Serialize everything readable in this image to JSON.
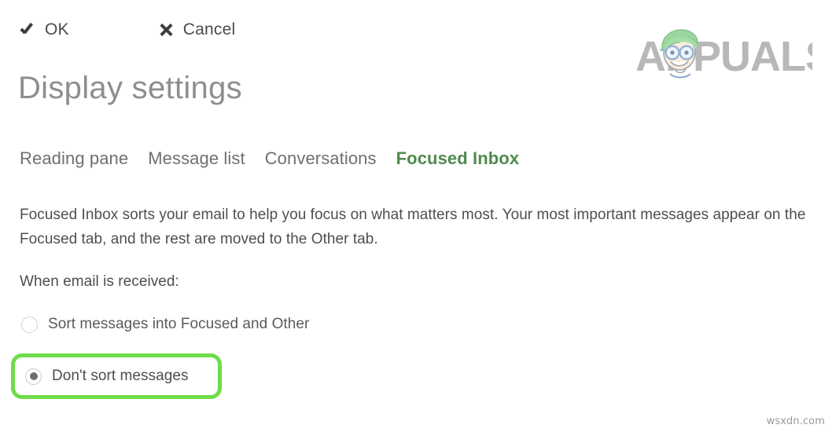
{
  "command_bar": {
    "buttons": [
      {
        "label": "OK",
        "icon": "check-icon"
      },
      {
        "label": "Cancel",
        "icon": "close-x-icon"
      }
    ]
  },
  "header": {
    "title": "Display settings"
  },
  "tabs": [
    {
      "label": "Reading pane",
      "active": false
    },
    {
      "label": "Message list",
      "active": false
    },
    {
      "label": "Conversations",
      "active": false
    },
    {
      "label": "Focused Inbox",
      "active": true
    }
  ],
  "main": {
    "description": "Focused Inbox sorts your email to help you focus on what matters most. Your most important messages appear on the Focused tab, and the rest are moved to the Other tab.",
    "section_label": "When email is received:",
    "radio_options": [
      {
        "label": "Sort messages into Focused and Other",
        "selected": false,
        "highlighted": false
      },
      {
        "label": "Don't sort messages",
        "selected": true,
        "highlighted": true
      }
    ]
  },
  "branding": {
    "logo_text": "APPUALS",
    "logo_mark": "appuals-character-icon",
    "watermark": "wsxdn.com"
  },
  "colors": {
    "active_tab_green": "#4f8a4f",
    "highlight_green": "#6edc4a",
    "title_gray": "#8e8e8e",
    "body_gray": "#4e4e4e",
    "logo_gray": "#8d8d8d",
    "logo_hair_green": "#5cbf63"
  }
}
